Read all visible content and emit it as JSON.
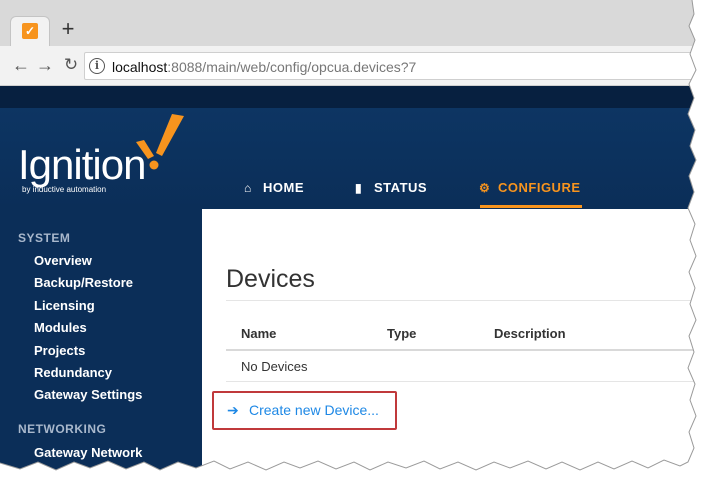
{
  "browser": {
    "new_tab_symbol": "+",
    "url_host": "localhost",
    "url_rest": ":8088/main/web/config/opcua.devices?7",
    "icons": {
      "back": "arrow-left-icon",
      "forward": "arrow-right-icon",
      "reload": "reload-icon",
      "info": "info-icon"
    }
  },
  "app": {
    "logo_text": "Ignition",
    "logo_tagline": "by inductive automation",
    "nav": {
      "home": "HOME",
      "status": "STATUS",
      "configure": "CONFIGURE",
      "active": "configure"
    },
    "colors": {
      "header": "#0b2e58",
      "accent": "#f7941e",
      "link": "#1e88e5",
      "highlight_box": "#c0393b"
    }
  },
  "sidebar": {
    "sections": [
      {
        "title": "SYSTEM",
        "items": [
          "Overview",
          "Backup/Restore",
          "Licensing",
          "Modules",
          "Projects",
          "Redundancy",
          "Gateway Settings"
        ]
      },
      {
        "title": "NETWORKING",
        "items": [
          "Gateway Network"
        ]
      }
    ]
  },
  "main": {
    "title": "Devices",
    "table": {
      "columns": [
        "Name",
        "Type",
        "Description"
      ],
      "empty_text": "No Devices"
    },
    "create_link": "Create new Device..."
  }
}
